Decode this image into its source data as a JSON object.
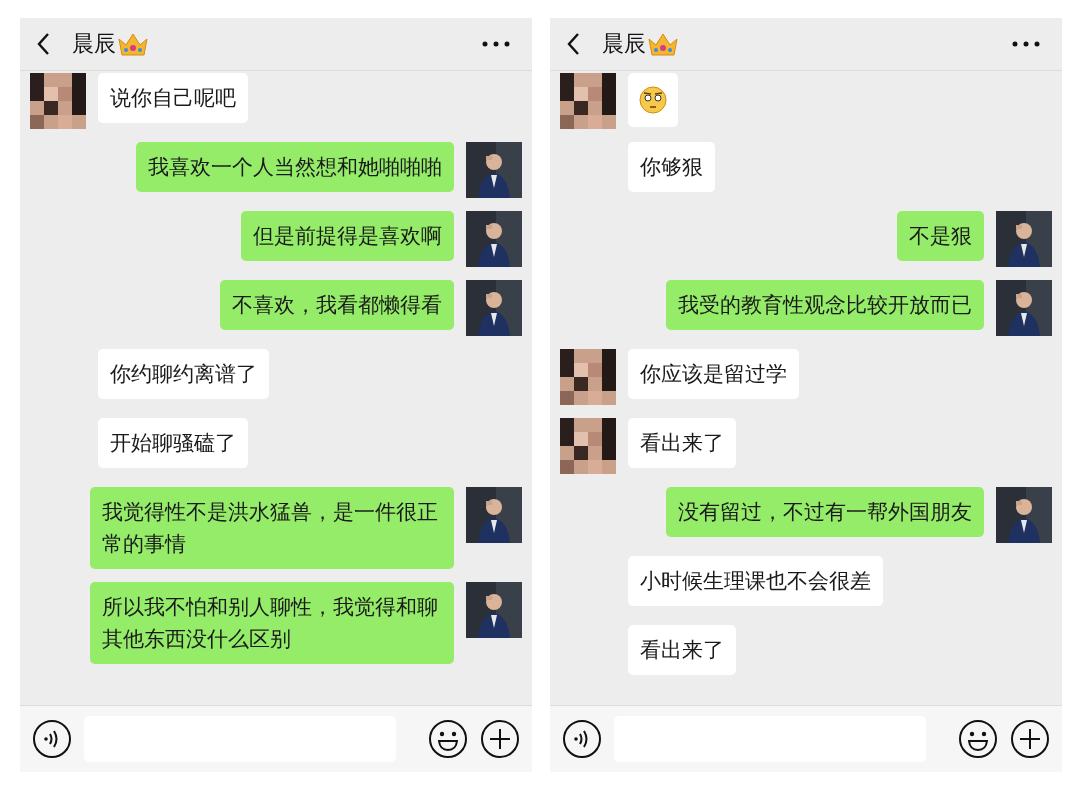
{
  "panels": [
    {
      "title": "晨辰",
      "messages": [
        {
          "kind": "text",
          "outgoing": false,
          "avatar": true,
          "text": "说你自己呢吧"
        },
        {
          "kind": "text",
          "outgoing": true,
          "avatar": true,
          "text": "我喜欢一个人当然想和她啪啪啪"
        },
        {
          "kind": "text",
          "outgoing": true,
          "avatar": true,
          "text": "但是前提得是喜欢啊"
        },
        {
          "kind": "text",
          "outgoing": true,
          "avatar": true,
          "text": "不喜欢，我看都懒得看"
        },
        {
          "kind": "text",
          "outgoing": false,
          "avatar": false,
          "text": "你约聊约离谱了"
        },
        {
          "kind": "text",
          "outgoing": false,
          "avatar": false,
          "text": "开始聊骚磕了"
        },
        {
          "kind": "text",
          "outgoing": true,
          "avatar": true,
          "text": "我觉得性不是洪水猛兽，是一件很正常的事情"
        },
        {
          "kind": "text",
          "outgoing": true,
          "avatar": true,
          "text": "所以我不怕和别人聊性，我觉得和聊其他东西没什么区别"
        }
      ]
    },
    {
      "title": "晨辰",
      "messages": [
        {
          "kind": "sticker",
          "outgoing": false,
          "avatar": true
        },
        {
          "kind": "text",
          "outgoing": false,
          "avatar": false,
          "text": "你够狠"
        },
        {
          "kind": "text",
          "outgoing": true,
          "avatar": true,
          "text": "不是狠"
        },
        {
          "kind": "text",
          "outgoing": true,
          "avatar": true,
          "text": "我受的教育性观念比较开放而已"
        },
        {
          "kind": "text",
          "outgoing": false,
          "avatar": true,
          "text": "你应该是留过学"
        },
        {
          "kind": "text",
          "outgoing": false,
          "avatar": true,
          "text": "看出来了"
        },
        {
          "kind": "text",
          "outgoing": true,
          "avatar": true,
          "text": "没有留过，不过有一帮外国朋友"
        },
        {
          "kind": "text",
          "outgoing": false,
          "avatar": false,
          "text": "小时候生理课也不会很差"
        },
        {
          "kind": "text",
          "outgoing": false,
          "avatar": false,
          "text": "看出来了"
        }
      ]
    }
  ]
}
